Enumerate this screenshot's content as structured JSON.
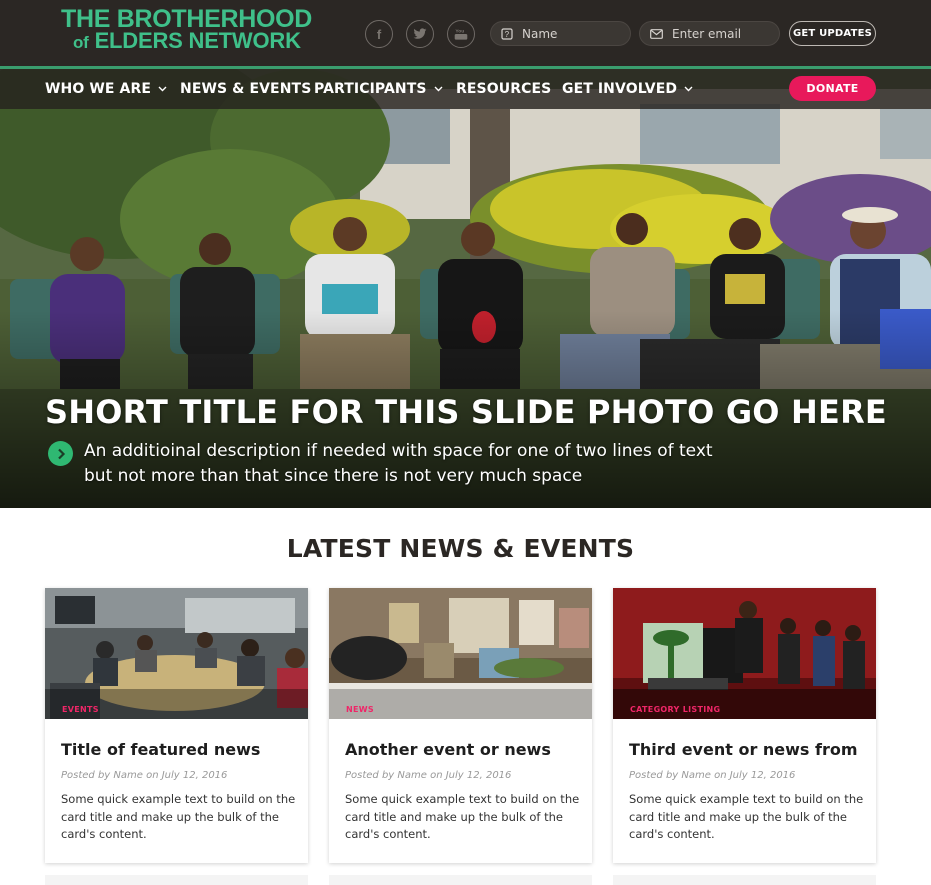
{
  "brand": {
    "line1": "THE BROTHERHOOD",
    "line2_small": "of",
    "line2": "ELDERS NETWORK",
    "color": "#3fc08a"
  },
  "header": {
    "social_icons": [
      "facebook-icon",
      "twitter-icon",
      "youtube-icon"
    ],
    "name_placeholder": "Name",
    "email_placeholder": "Enter email",
    "get_updates_label": "GET UPDATES"
  },
  "nav": {
    "items": [
      {
        "label": "WHO WE ARE",
        "dropdown": true
      },
      {
        "label": "NEWS & EVENTS",
        "dropdown": false
      },
      {
        "label": "PARTICIPANTS",
        "dropdown": true
      },
      {
        "label": "RESOURCES",
        "dropdown": false
      },
      {
        "label": "GET INVOLVED",
        "dropdown": true
      }
    ],
    "donate_label": "DONATE",
    "donate_color": "#e8195b"
  },
  "hero": {
    "title": "SHORT TITLE FOR THIS SLIDE PHOTO GO HERE",
    "description": "An additioinal description if needed with space for one of two lines of text but not more than that since there is not very much space"
  },
  "section": {
    "title": "LATEST NEWS & EVENTS"
  },
  "cards": [
    {
      "category": "EVENTS",
      "title": "Title of featured news",
      "meta": "Posted by Name on July 12, 2016",
      "body": "Some quick example text to build on the card title and make up the bulk of the card's content."
    },
    {
      "category": "NEWS",
      "title": "Another event or news",
      "meta": "Posted by Name on July 12, 2016",
      "body": "Some quick example text to build on the card title and make up the bulk of the card's content."
    },
    {
      "category": "CATEGORY LISTING",
      "title": "Third event or news from",
      "meta": "Posted by Name on July 12, 2016",
      "body": "Some quick example text to build on the card title and make up the bulk of the card's content."
    }
  ]
}
